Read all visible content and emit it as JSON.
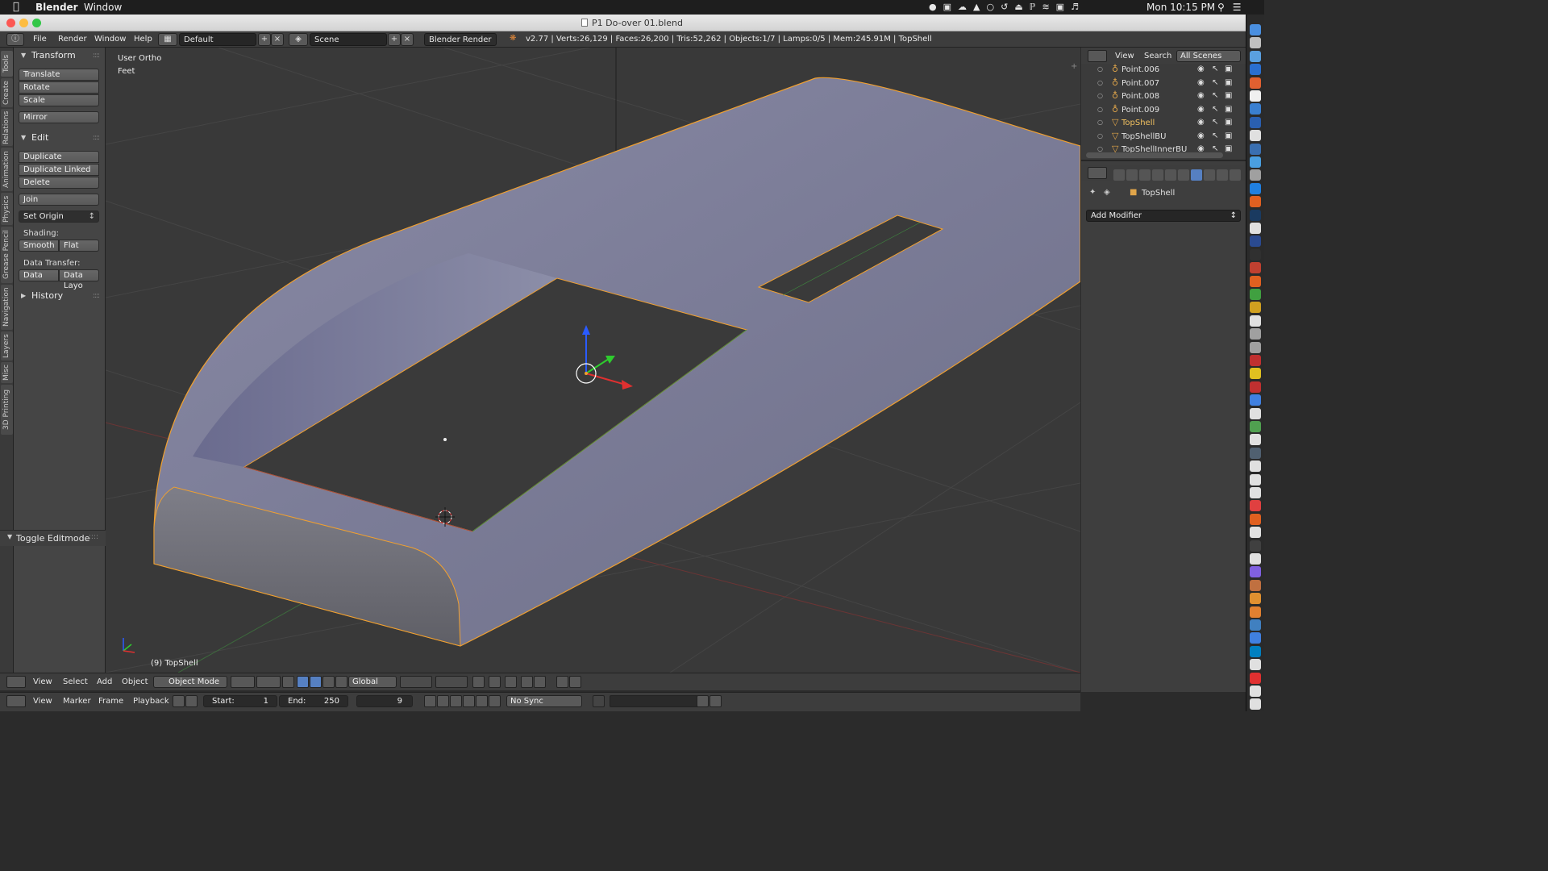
{
  "mac_menubar": {
    "app_name": "Blender",
    "window_menu": "Window",
    "clock": "Mon 10:15 PM"
  },
  "window": {
    "title": "P1 Do-over 01.blend"
  },
  "info_header": {
    "menus": [
      "File",
      "Render",
      "Window",
      "Help"
    ],
    "layout": "Default",
    "scene": "Scene",
    "render_engine": "Blender Render",
    "stats": "v2.77 | Verts:26,129 | Faces:26,200 | Tris:52,262 | Objects:1/7 | Lamps:0/5 | Mem:245.91M | TopShell"
  },
  "tool_tabs": [
    "Tools",
    "Create",
    "Relations",
    "Animation",
    "Physics",
    "Grease Pencil",
    "Navigation",
    "Layers",
    "Misc",
    "3D Printing"
  ],
  "tool_shelf": {
    "transform": {
      "title": "Transform",
      "buttons": [
        "Translate",
        "Rotate",
        "Scale"
      ],
      "mirror": "Mirror"
    },
    "edit": {
      "title": "Edit",
      "buttons": [
        "Duplicate",
        "Duplicate Linked",
        "Delete"
      ],
      "join": "Join",
      "set_origin": "Set Origin",
      "shading_label": "Shading:",
      "shading_smooth": "Smooth",
      "shading_flat": "Flat",
      "data_transfer_label": "Data Transfer:",
      "data": "Data",
      "data_layout": "Data Layo"
    },
    "history": "History",
    "operator_panel": "Toggle Editmode"
  },
  "viewport": {
    "view_name": "User Ortho",
    "units": "Feet",
    "object_label": "(9) TopShell"
  },
  "view_header": {
    "menus": [
      "View",
      "Select",
      "Add",
      "Object"
    ],
    "mode": "Object Mode",
    "orientation": "Global"
  },
  "timeline": {
    "menus": [
      "View",
      "Marker",
      "Frame",
      "Playback"
    ],
    "start_label": "Start:",
    "start": "1",
    "end_label": "End:",
    "end": "250",
    "current_frame": "9",
    "sync": "No Sync"
  },
  "outliner": {
    "menus": [
      "View",
      "Search"
    ],
    "filter": "All Scenes",
    "rows": [
      {
        "name": "Point.006",
        "type": "lamp"
      },
      {
        "name": "Point.007",
        "type": "lamp"
      },
      {
        "name": "Point.008",
        "type": "lamp"
      },
      {
        "name": "Point.009",
        "type": "lamp"
      },
      {
        "name": "TopShell",
        "type": "mesh",
        "selected": true
      },
      {
        "name": "TopShellBU",
        "type": "mesh"
      },
      {
        "name": "TopShellInnerBU",
        "type": "mesh"
      }
    ]
  },
  "properties": {
    "context_object": "TopShell",
    "add_modifier": "Add Modifier"
  },
  "colors": {
    "selection_outline": "#f0a030",
    "active_tab": "#5680c2",
    "mesh_face": "#7c7d9a"
  }
}
